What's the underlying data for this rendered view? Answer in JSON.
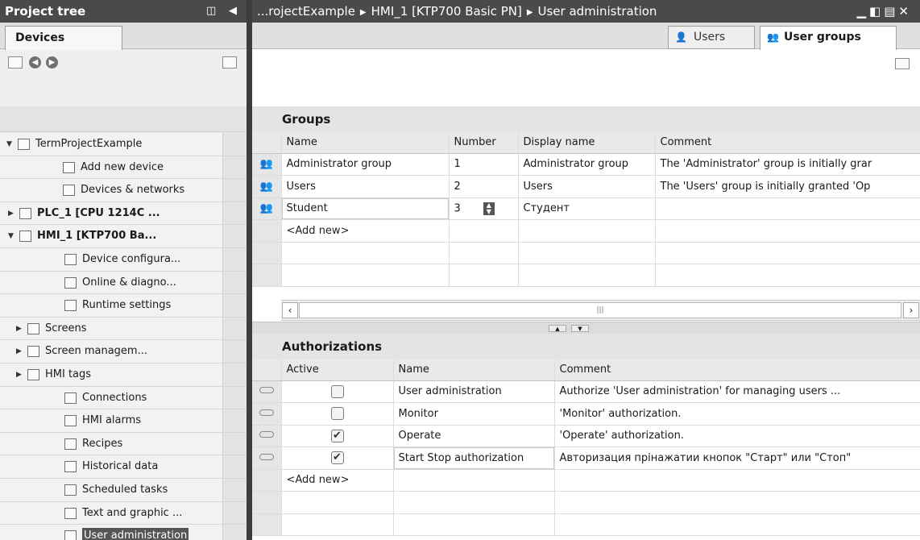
{
  "project_tree": {
    "title": "Project tree",
    "tab_devices": "Devices",
    "items": [
      {
        "label": "TermProjectExample",
        "arrow": "▼",
        "level": 0,
        "bold": false
      },
      {
        "label": "Add new device",
        "arrow": "",
        "level": 2,
        "bold": false
      },
      {
        "label": "Devices & networks",
        "arrow": "",
        "level": 2,
        "bold": false
      },
      {
        "label": "PLC_1 [CPU 1214C ...",
        "arrow": "▶",
        "level": 1,
        "bold": true
      },
      {
        "label": "HMI_1 [KTP700 Ba...",
        "arrow": "▼",
        "level": 1,
        "bold": true
      },
      {
        "label": "Device configura...",
        "arrow": "",
        "level": 3,
        "bold": false
      },
      {
        "label": "Online & diagno...",
        "arrow": "",
        "level": 3,
        "bold": false
      },
      {
        "label": "Runtime settings",
        "arrow": "",
        "level": 3,
        "bold": false
      },
      {
        "label": "Screens",
        "arrow": "▶",
        "level": 2,
        "bold": false
      },
      {
        "label": "Screen managem...",
        "arrow": "▶",
        "level": 2,
        "bold": false
      },
      {
        "label": "HMI tags",
        "arrow": "▶",
        "level": 2,
        "bold": false
      },
      {
        "label": "Connections",
        "arrow": "",
        "level": 3,
        "bold": false
      },
      {
        "label": "HMI alarms",
        "arrow": "",
        "level": 3,
        "bold": false
      },
      {
        "label": "Recipes",
        "arrow": "",
        "level": 3,
        "bold": false
      },
      {
        "label": "Historical data",
        "arrow": "",
        "level": 3,
        "bold": false
      },
      {
        "label": "Scheduled tasks",
        "arrow": "",
        "level": 3,
        "bold": false
      },
      {
        "label": "Text and graphic ...",
        "arrow": "",
        "level": 3,
        "bold": false
      },
      {
        "label": "User administration",
        "arrow": "",
        "level": 3,
        "bold": false,
        "selected": true
      }
    ]
  },
  "editor": {
    "breadcrumb": [
      "...rojectExample",
      "HMI_1 [KTP700 Basic PN]",
      "User administration"
    ],
    "tab_users": "Users",
    "tab_user_groups": "User groups",
    "groups": {
      "title": "Groups",
      "columns": [
        "Name",
        "Number",
        "Display name",
        "Comment"
      ],
      "rows": [
        {
          "name": "Administrator group",
          "number": "1",
          "display": "Administrator group",
          "comment": "The 'Administrator' group is initially grar"
        },
        {
          "name": "Users",
          "number": "2",
          "display": "Users",
          "comment": "The 'Users' group is initially granted 'Op"
        },
        {
          "name": "Student",
          "number": "3",
          "display": "Студент",
          "comment": ""
        }
      ],
      "add_new": "<Add new>"
    },
    "authorizations": {
      "title": "Authorizations",
      "columns": [
        "Active",
        "Name",
        "Comment"
      ],
      "rows": [
        {
          "active": false,
          "name": "User administration",
          "comment": "Authorize 'User administration' for managing users ..."
        },
        {
          "active": false,
          "name": "Monitor",
          "comment": "'Monitor' authorization."
        },
        {
          "active": true,
          "name": "Operate",
          "comment": "'Operate' authorization."
        },
        {
          "active": true,
          "name": "Start Stop authorization",
          "comment": "Авторизация прінажатии кнопок \"Старт\" или \"Стоп\""
        }
      ],
      "add_new": "<Add new>"
    }
  }
}
